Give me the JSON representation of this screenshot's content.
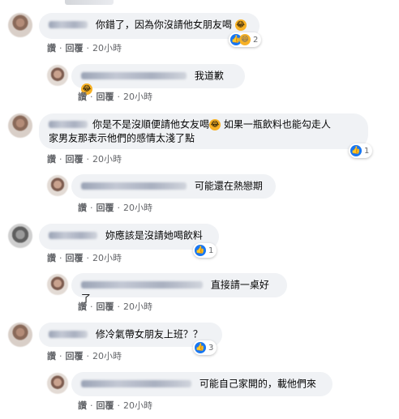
{
  "actions": {
    "like": "讚",
    "reply": "回覆",
    "time": "20小時"
  },
  "comments": [
    {
      "text": "你錯了，因為你沒請他女朋友喝",
      "reaction_count": "2"
    },
    {
      "text": "我道歉"
    },
    {
      "text_line1": "你是不是沒順便請他女友喝",
      "text_line1b": " 如果一瓶飲料也能勾走人",
      "text_line2": "家男友那表示他們的感情太淺了點",
      "reaction_count": "1"
    },
    {
      "text": "可能還在熱戀期"
    },
    {
      "text": "妳應該是沒請她喝飲料",
      "reaction_count": "1"
    },
    {
      "text": "直接請一桌好了"
    },
    {
      "text": "修冷氣帶女朋友上班？？",
      "reaction_count": "3"
    },
    {
      "text": "可能自己家開的，載他們來"
    }
  ],
  "colors": {
    "like_blue": "#1877f2",
    "bubble_bg": "#f0f2f5",
    "meta_gray": "#65676b"
  },
  "icons": [
    "like-icon",
    "haha-icon",
    "laughing-emoji"
  ]
}
